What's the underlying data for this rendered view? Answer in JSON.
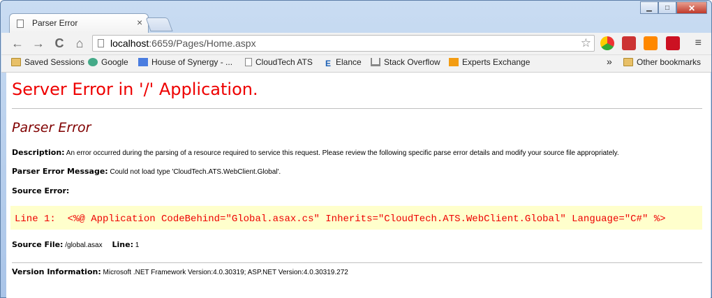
{
  "window": {
    "tab_title": "Parser Error",
    "tab_close": "×",
    "minimize": "▁",
    "maximize": "□",
    "close": "✕"
  },
  "toolbar": {
    "url_host": "localhost",
    "url_rest": ":6659/Pages/Home.aspx",
    "back": "←",
    "forward": "→",
    "reload": "C",
    "home": "⌂",
    "star": "☆",
    "menu": "≡"
  },
  "bookmarks": {
    "items": [
      {
        "label": "Saved Sessions",
        "icon": "folder-icon"
      },
      {
        "label": "Google",
        "icon": "google-icon"
      },
      {
        "label": "House of Synergy - ...",
        "icon": "google-apps-icon"
      },
      {
        "label": "CloudTech ATS",
        "icon": "page-icon"
      },
      {
        "label": "Elance",
        "icon": "elance-icon"
      },
      {
        "label": "Stack Overflow",
        "icon": "stackoverflow-icon"
      },
      {
        "label": "Experts Exchange",
        "icon": "experts-exchange-icon"
      }
    ],
    "overflow": "»",
    "other": "Other bookmarks"
  },
  "page": {
    "title": "Server Error in '/' Application.",
    "subtitle": "Parser Error",
    "description_label": "Description:",
    "description": "An error occurred during the parsing of a resource required to service this request. Please review the following specific parse error details and modify your source file appropriately.",
    "message_label": "Parser Error Message:",
    "message": "Could not load type 'CloudTech.ATS.WebClient.Global'.",
    "source_error_label": "Source Error:",
    "code_line": "Line 1:  <%@ Application CodeBehind=\"Global.asax.cs\" Inherits=\"CloudTech.ATS.WebClient.Global\" Language=\"C#\" %>",
    "source_file_label": "Source File:",
    "source_file": "/global.asax",
    "line_label": "Line:",
    "line_number": "1",
    "version_label": "Version Information:",
    "version": "Microsoft .NET Framework Version:4.0.30319; ASP.NET Version:4.0.30319.272"
  },
  "colors": {
    "title": "#ff0000",
    "subtitle": "#800000",
    "code_bg": "#ffffcc"
  }
}
